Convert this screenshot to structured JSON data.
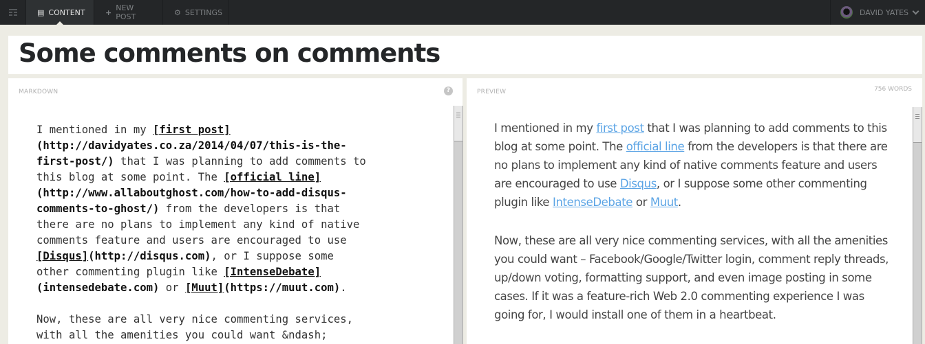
{
  "nav": {
    "items": [
      {
        "label": "CONTENT",
        "icon": "content-icon",
        "active": true
      },
      {
        "label": "NEW POST",
        "icon": "plus-icon",
        "active": false
      },
      {
        "label": "SETTINGS",
        "icon": "gears-icon",
        "active": false
      }
    ],
    "user": {
      "name": "DAVID YATES"
    }
  },
  "post": {
    "title": "Some comments on comments"
  },
  "markdown": {
    "header": "MARKDOWN",
    "help": "?"
  },
  "preview": {
    "header": "PREVIEW",
    "word_count": "756 WORDS",
    "paragraphs": [
      {
        "parts": [
          {
            "t": "I mentioned in my "
          },
          {
            "a": "first post"
          },
          {
            "t": " that I was planning to add comments to this blog at some point. The "
          },
          {
            "a": "official line"
          },
          {
            "t": " from the developers is that there are no plans to implement any kind of native comments feature and users are encouraged to use "
          },
          {
            "a": "Disqus"
          },
          {
            "t": ", or I suppose some other commenting plugin like "
          },
          {
            "a": "IntenseDebate"
          },
          {
            "t": " or "
          },
          {
            "a": "Muut"
          },
          {
            "t": "."
          }
        ]
      },
      {
        "parts": [
          {
            "t": "Now, these are all very nice commenting services, with all the amenities you could want – Facebook/Google/Twitter login, comment reply threads, up/down voting, formatting support, and even image posting in some cases. If it was a feature-rich Web 2.0 commenting experience I was going for, I would install one of them in a heartbeat."
          }
        ]
      }
    ]
  },
  "markdown_lines": [
    [
      {
        "t": "I mentioned in my "
      },
      {
        "b": "[first post]",
        "u": true
      }
    ],
    [
      {
        "b": "(http://davidyates.co.za/2014/04/07/this-is-the-"
      }
    ],
    [
      {
        "b": "first-post/)"
      },
      {
        "t": " that I was planning to add comments to"
      }
    ],
    [
      {
        "t": "this blog at some point. The "
      },
      {
        "b": "[official line]",
        "u": true
      }
    ],
    [
      {
        "b": "(http://www.allaboutghost.com/how-to-add-disqus-"
      }
    ],
    [
      {
        "b": "comments-to-ghost/)"
      },
      {
        "t": " from the developers is that"
      }
    ],
    [
      {
        "t": "there are no plans to implement any kind of native"
      }
    ],
    [
      {
        "t": "comments feature and users are encouraged to use"
      }
    ],
    [
      {
        "b": "[Disqus]",
        "u": true
      },
      {
        "b": "(http://disqus.com)"
      },
      {
        "t": ", or I suppose some"
      }
    ],
    [
      {
        "t": "other commenting plugin like "
      },
      {
        "b": "[IntenseDebate]",
        "u": true
      }
    ],
    [
      {
        "b": "(intensedebate.com)"
      },
      {
        "t": " or "
      },
      {
        "b": "[Muut]",
        "u": true
      },
      {
        "b": "(https://muut.com)"
      },
      {
        "t": "."
      }
    ],
    [
      {
        "t": ""
      }
    ],
    [
      {
        "t": "Now, these are all very nice commenting services,"
      }
    ],
    [
      {
        "t": "with all the amenities you could want &ndash;"
      }
    ]
  ]
}
